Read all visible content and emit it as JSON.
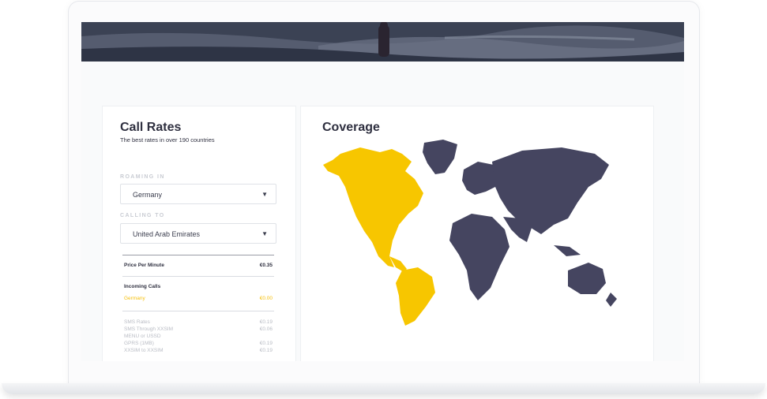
{
  "call_rates": {
    "title": "Call Rates",
    "subtitle": "The best rates in over 190 countries",
    "roaming_label": "ROAMING IN",
    "roaming_value": "Germany",
    "calling_label": "CALLING TO",
    "calling_value": "United Arab Emirates",
    "price_label": "Price Per Minute",
    "price_value": "€0.35",
    "incoming_label": "Incoming Calls",
    "incoming_country": "Germany",
    "incoming_value": "€0.00",
    "details": [
      {
        "label": "SMS Rates",
        "value": "€0.19"
      },
      {
        "label": "SMS Through XXSIM",
        "value": "€0.06"
      },
      {
        "label": "MENU or USSD",
        "value": ""
      },
      {
        "label": "GPRS (1MB)",
        "value": "€0.19"
      },
      {
        "label": "XXSIM to XXSIM",
        "value": "€0.19"
      }
    ]
  },
  "coverage": {
    "title": "Coverage",
    "colors": {
      "highlight": "#f7c600",
      "land": "#454560"
    }
  }
}
